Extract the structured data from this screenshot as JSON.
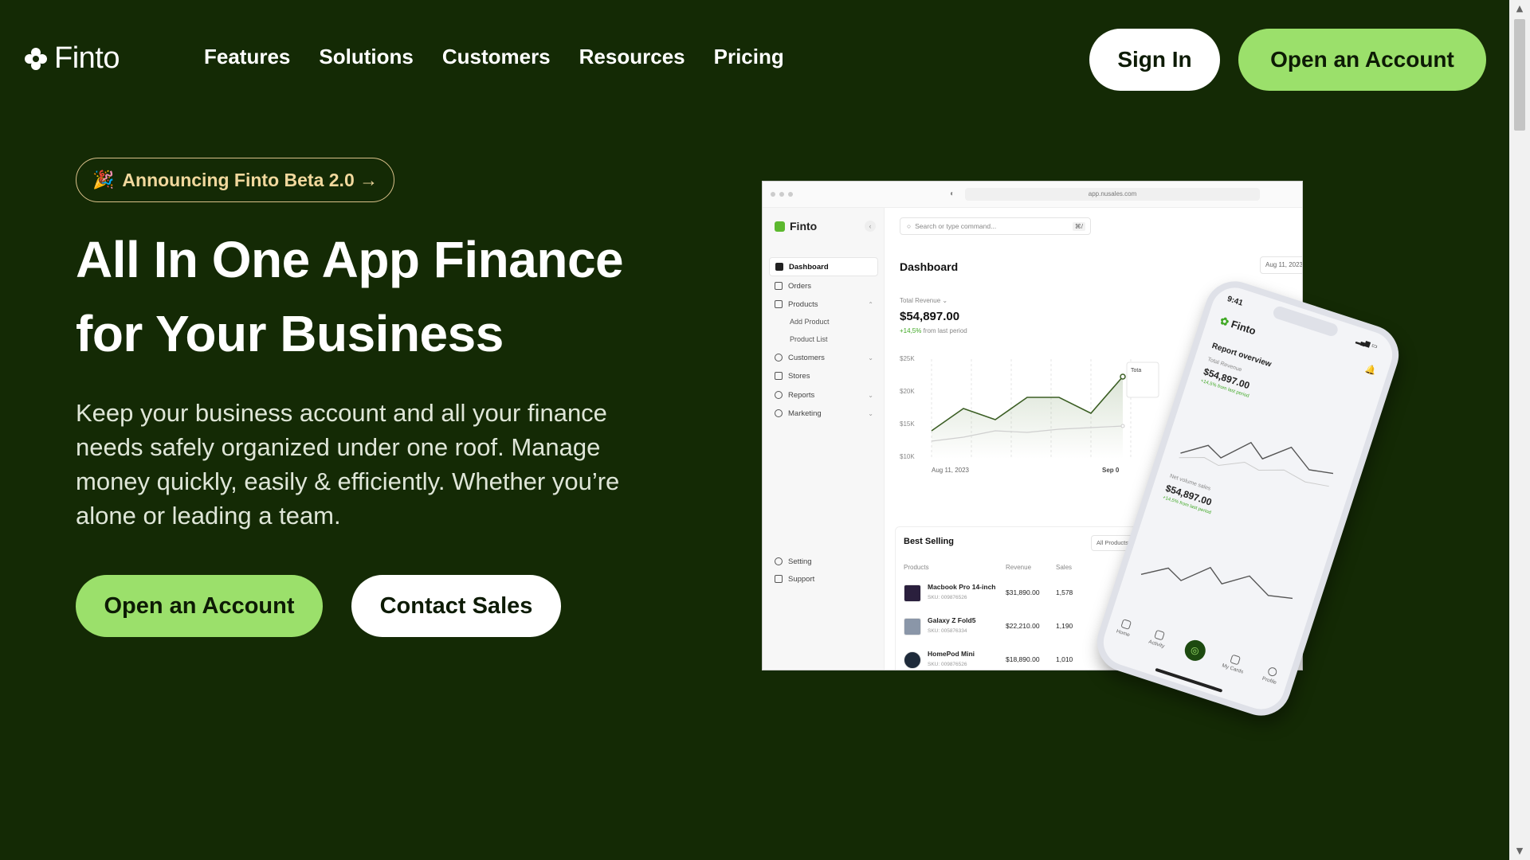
{
  "nav": {
    "brand": "Finto",
    "links": [
      "Features",
      "Solutions",
      "Customers",
      "Resources",
      "Pricing"
    ],
    "sign_in": "Sign In",
    "open_account": "Open an Account"
  },
  "hero": {
    "announcement": "Announcing Finto Beta 2.0 →",
    "headline_line1": "All In One App Finance",
    "headline_line2": "for Your Business",
    "lead": "Keep your business account and all your finance needs safely organized under one roof. Manage money quickly, easily & efficiently. Whether you’re alone or leading a team.",
    "primary_cta": "Open an Account",
    "secondary_cta": "Contact Sales"
  },
  "dashboard_mock": {
    "url": "app.nusales.com",
    "brand": "Finto",
    "search_placeholder": "Search or type command...",
    "search_shortcut": "⌘/",
    "sidebar": {
      "items": [
        {
          "label": "Dashboard",
          "active": true
        },
        {
          "label": "Orders"
        },
        {
          "label": "Products"
        },
        {
          "label": "Customers"
        },
        {
          "label": "Stores"
        },
        {
          "label": "Reports"
        },
        {
          "label": "Marketing"
        }
      ],
      "product_sub": [
        "Add Product",
        "Product List"
      ],
      "footer": [
        "Setting",
        "Support"
      ]
    },
    "title": "Dashboard",
    "date_button": "Aug 11, 2023",
    "revenue_label": "Total Revenue",
    "revenue_value": "$54,897.00",
    "revenue_change": "+14,5%",
    "revenue_change_suffix": "from last period",
    "chart": {
      "y_ticks": [
        "$25K",
        "$20K",
        "$15K",
        "$10K"
      ],
      "x_start": "Aug 11, 2023",
      "x_end": "Sep 0",
      "tooltip_label": "Tota"
    },
    "best_selling": {
      "title": "Best Selling",
      "filter": "All Products",
      "headers": [
        "Products",
        "Revenue",
        "Sales"
      ],
      "rows": [
        {
          "name": "Macbook Pro 14-inch",
          "sku": "SKU: 009876526",
          "revenue": "$31,890.00",
          "sales": "1,578"
        },
        {
          "name": "Galaxy Z Fold5",
          "sku": "SKU: 005876334",
          "revenue": "$22,210.00",
          "sales": "1,190"
        },
        {
          "name": "HomePod Mini",
          "sku": "SKU: 009876526",
          "revenue": "$18,890.00",
          "sales": "1,010"
        }
      ]
    }
  },
  "phone_mock": {
    "time": "9:41",
    "brand": "Finto",
    "report_title": "Report overview",
    "total_label": "Total Revenue",
    "total_value": "$54,897.00",
    "total_change": "+14,5% from last period",
    "net_label": "Net volume sales",
    "net_value": "$54,897.00",
    "net_change": "+14,5% from last period",
    "tabs": [
      "Home",
      "Activity",
      "My Cards",
      "Profile"
    ]
  },
  "colors": {
    "background": "#142a05",
    "accent_green": "#9be06b",
    "announcement_gold": "#f1d89d"
  }
}
